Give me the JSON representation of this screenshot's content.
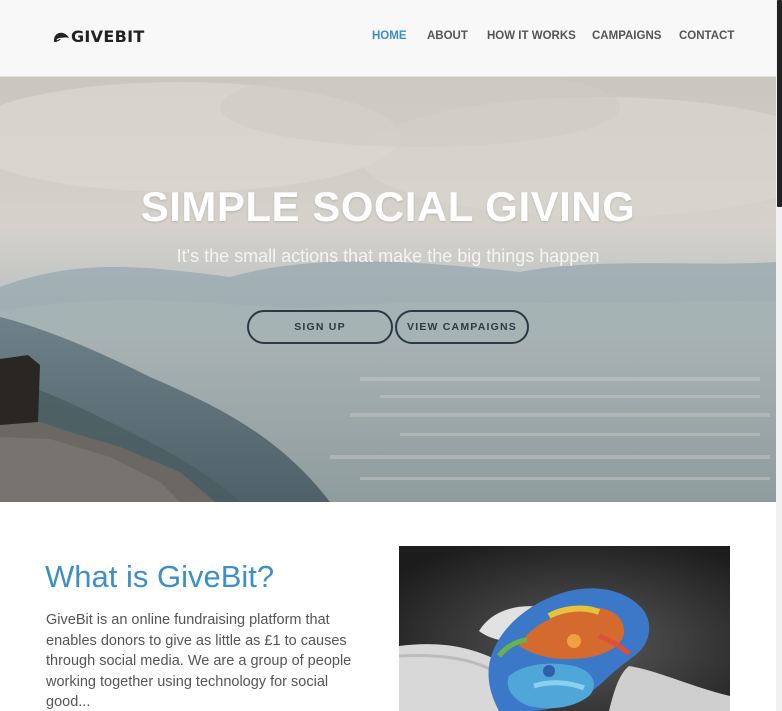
{
  "header": {
    "logo_text": "GIVEBIT",
    "logo_icon": "leaf-hand-icon",
    "nav": [
      {
        "label": "HOME",
        "active": true
      },
      {
        "label": "ABOUT",
        "active": false
      },
      {
        "label": "HOW IT WORKS",
        "active": false
      },
      {
        "label": "CAMPAIGNS",
        "active": false
      },
      {
        "label": "CONTACT",
        "active": false
      }
    ]
  },
  "hero": {
    "title": "SIMPLE SOCIAL GIVING",
    "subtitle": "It's the small actions that make the big things happen",
    "signup_label": "SIGN UP",
    "campaigns_label": "VIEW CAMPAIGNS"
  },
  "about": {
    "title": "What is GiveBit?",
    "text": "GiveBit is an online fundraising platform that enables donors to give as little as £1 to causes through social media. We are a group of people working together using technology for social good..."
  },
  "colors": {
    "accent": "#3d8fc6",
    "header_bg": "#f8f8f8",
    "button_border": "#2a3a44"
  }
}
